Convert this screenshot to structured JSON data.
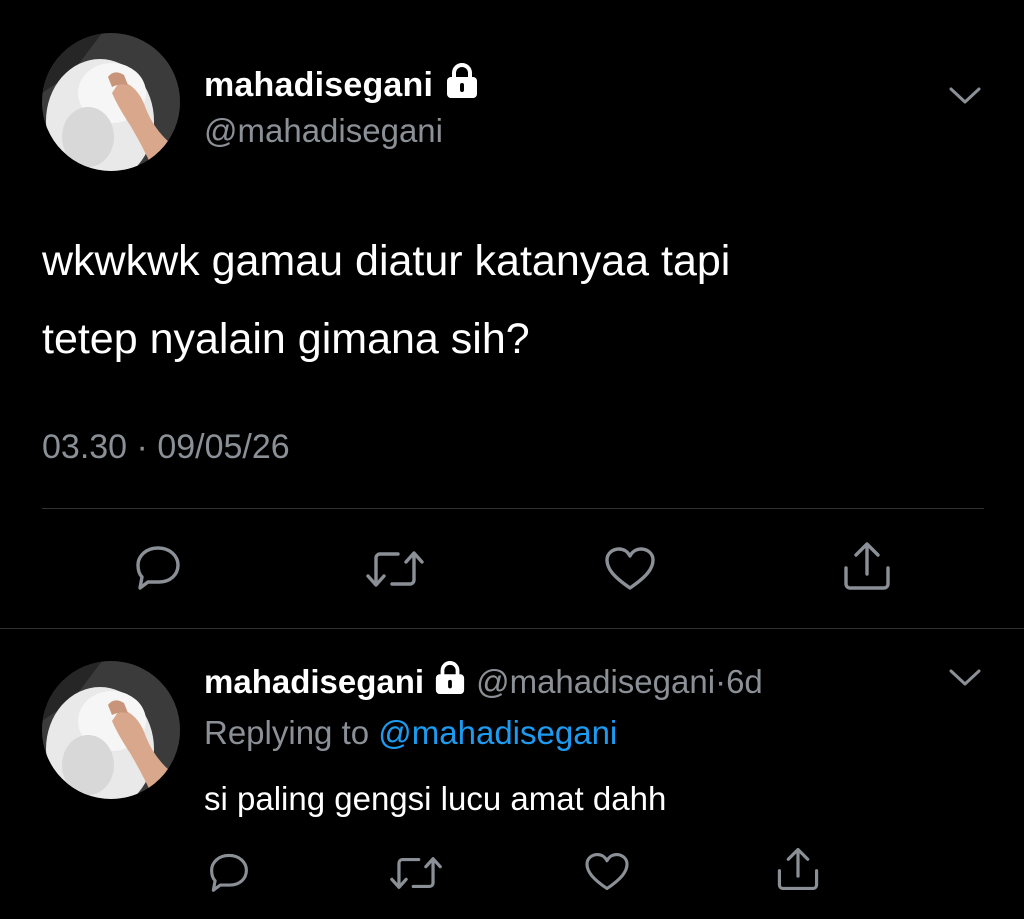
{
  "main_tweet": {
    "display_name": "mahadisegani",
    "handle": "@mahadisegani",
    "body": "wkwkwk gamau diatur katanyaa tapi\ntetep nyalain gimana sih?",
    "time": "03.30",
    "separator": "·",
    "date": "09/05/26",
    "protected_icon": "lock-icon",
    "menu_icon": "chevron-down-icon",
    "actions": [
      "reply-icon",
      "retweet-icon",
      "like-icon",
      "share-icon"
    ]
  },
  "reply_tweet": {
    "display_name": "mahadisegani",
    "handle": "@mahadisegani",
    "separator": "·",
    "age": "6d",
    "replying_prefix": "Replying to",
    "replying_to": "@mahadisegani",
    "body": "si paling gengsi lucu amat dahh",
    "protected_icon": "lock-icon",
    "menu_icon": "chevron-down-icon",
    "actions": [
      "reply-icon",
      "retweet-icon",
      "like-icon",
      "share-icon"
    ]
  },
  "colors": {
    "background": "#000000",
    "primary_text": "#ffffff",
    "secondary_text": "#8b9097",
    "link": "#1d9bf0",
    "divider": "#2f3336"
  }
}
